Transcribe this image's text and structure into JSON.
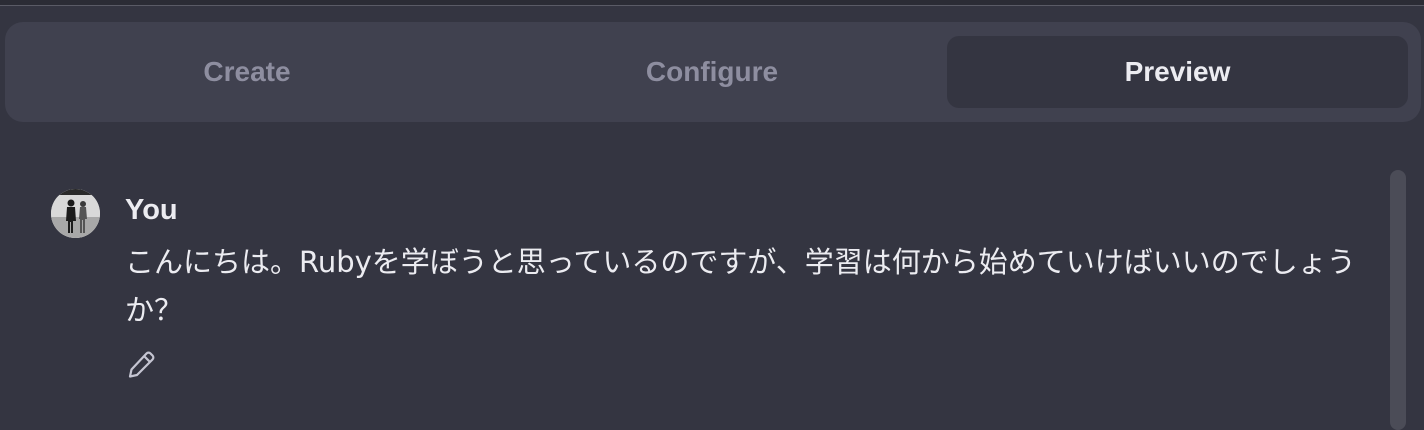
{
  "tabs": [
    {
      "label": "Create"
    },
    {
      "label": "Configure"
    },
    {
      "label": "Preview",
      "active": true
    }
  ],
  "chat": {
    "messages": [
      {
        "author": "You",
        "text": "こんにちは。Rubyを学ぼうと思っているのですが、学習は何から始めていけばいいのでしょうか？"
      }
    ]
  },
  "icons": {
    "avatar": "user-avatar",
    "edit": "pencil-icon"
  },
  "colors": {
    "background": "#343541",
    "tab_bar": "#40414f",
    "tab_active": "#343541",
    "text_primary": "#ececf1",
    "text_muted": "#8e8ea0"
  }
}
